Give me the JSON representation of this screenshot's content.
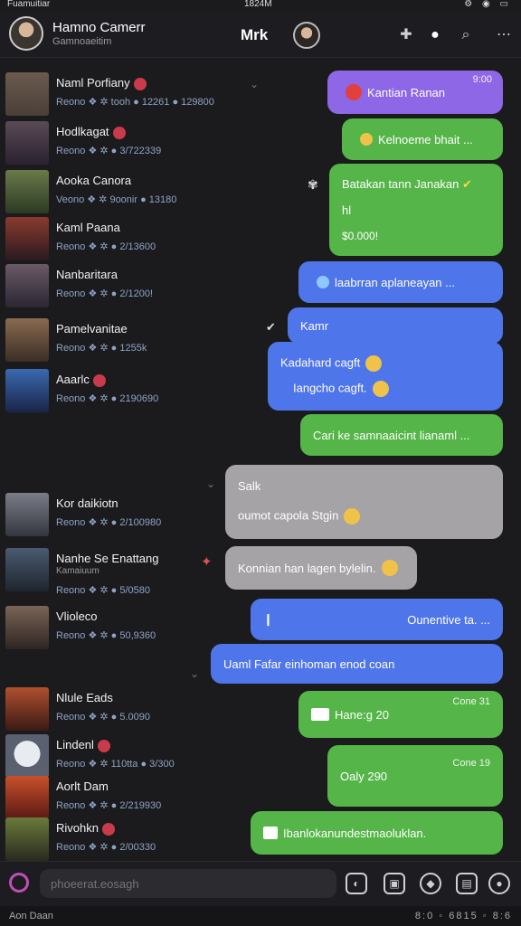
{
  "status_bar": {
    "carrier": "Fuamuitiar",
    "time": "1824M"
  },
  "header": {
    "title": "Hamno Camerr",
    "subtitle": "Gamnoaeitim",
    "center_label": "Mrk"
  },
  "contacts": [
    {
      "name": "Naml Porfiany",
      "meta": "Reono ❖ ✲ tooh ● 12261 ● 129800",
      "color": "#4a3f38"
    },
    {
      "name": "Hodlkagat",
      "meta": "Reono ❖ ✲ ● 3/722339",
      "color": "#3a2f36"
    },
    {
      "name": "Aooka Canora",
      "meta": "Veono ❖ ✲ 9oonir ● 13180",
      "color": "#3e5035"
    },
    {
      "name": "Kaml Paana",
      "meta": "Reono ❖ ✲ ● 2/13600",
      "color": "#5a2a2a"
    },
    {
      "name": "Nanbaritara",
      "meta": "Reono ❖ ✲ ● 2/1200!",
      "color": "#3c3742"
    },
    {
      "name": "Pamelvanitae",
      "meta": "Reono ❖ ✲ ● 1255k",
      "color": "#4a3b2e"
    },
    {
      "name": "Aaarlc",
      "meta": "Reono ❖ ✲ ● 2190690",
      "color": "#233a66"
    },
    {
      "name": "Kor daikiotn",
      "meta": "Reono ❖ ✲ ● 2/100980",
      "color": "#4b4c58"
    },
    {
      "name": "Nanhe Se Enattang",
      "sub": "Kamaiuum",
      "meta": "Reono ❖ ✲ ● 5/0580",
      "color": "#2f3844"
    },
    {
      "name": "Vlioleco",
      "meta": "Reono ❖ ✲ ● 50,9360",
      "color": "#3a322e"
    },
    {
      "name": "Nlule Eads",
      "meta": "Reono ❖ ✲ ● 5.0090",
      "color": "#6a2a1e"
    },
    {
      "name": "Lindenl",
      "meta": "Reono ❖ ✲ 110tta ● 3/300",
      "color": "#aeb6c0"
    },
    {
      "name": "Aorlt Dam",
      "meta": "Reono ❖ ✲ ● 2/219930",
      "color": "#7a2a1e"
    },
    {
      "name": "Rivohkn",
      "meta": "Reono ❖ ✲ ● 2/00330",
      "color": "#3c4a2a"
    }
  ],
  "messages": [
    {
      "text": "Kantian Ranan",
      "time": "9:00",
      "style": "purple"
    },
    {
      "text": "Kelnoeme bhait ...",
      "style": "green"
    },
    {
      "text": "Batakan tann Janakan",
      "line2": "hl",
      "line3": "$0.000!",
      "style": "green"
    },
    {
      "text": "laabrran aplaneayan ...",
      "style": "blue"
    },
    {
      "text": "Kamr",
      "style": "blue"
    },
    {
      "text": "Kadahard cagft",
      "line2": "Iangcho cagft.",
      "style": "blue"
    },
    {
      "text": "Cari ke samnaaicint lianaml ...",
      "style": "green"
    },
    {
      "text": "Salk",
      "line2": "oumot capola Stgin",
      "style": "gray"
    },
    {
      "text": "Konnian han lagen bylelin.",
      "style": "gray"
    },
    {
      "text": "Ounentive ta. ...",
      "style": "blue"
    },
    {
      "text": "Uaml Fafar einhoman enod coan",
      "style": "blue"
    },
    {
      "text": "Hane:g 20",
      "time": "Cone 31",
      "style": "green"
    },
    {
      "text": "Oaly 290",
      "time": "Cone 19",
      "style": "green"
    },
    {
      "text": "Ibanlokanundestmaoluklan.",
      "style": "green"
    }
  ],
  "composer": {
    "placeholder": "phoeerat.eosagh"
  },
  "footer": {
    "left": "Aon Daan",
    "right": "8:0 ◦ 6815 ◦ 8:6"
  },
  "colors": {
    "purple": "#8d67e6",
    "green": "#55b548",
    "blue": "#4f75ea",
    "gray": "#a5a3a5",
    "badge": "#c93b4a"
  }
}
